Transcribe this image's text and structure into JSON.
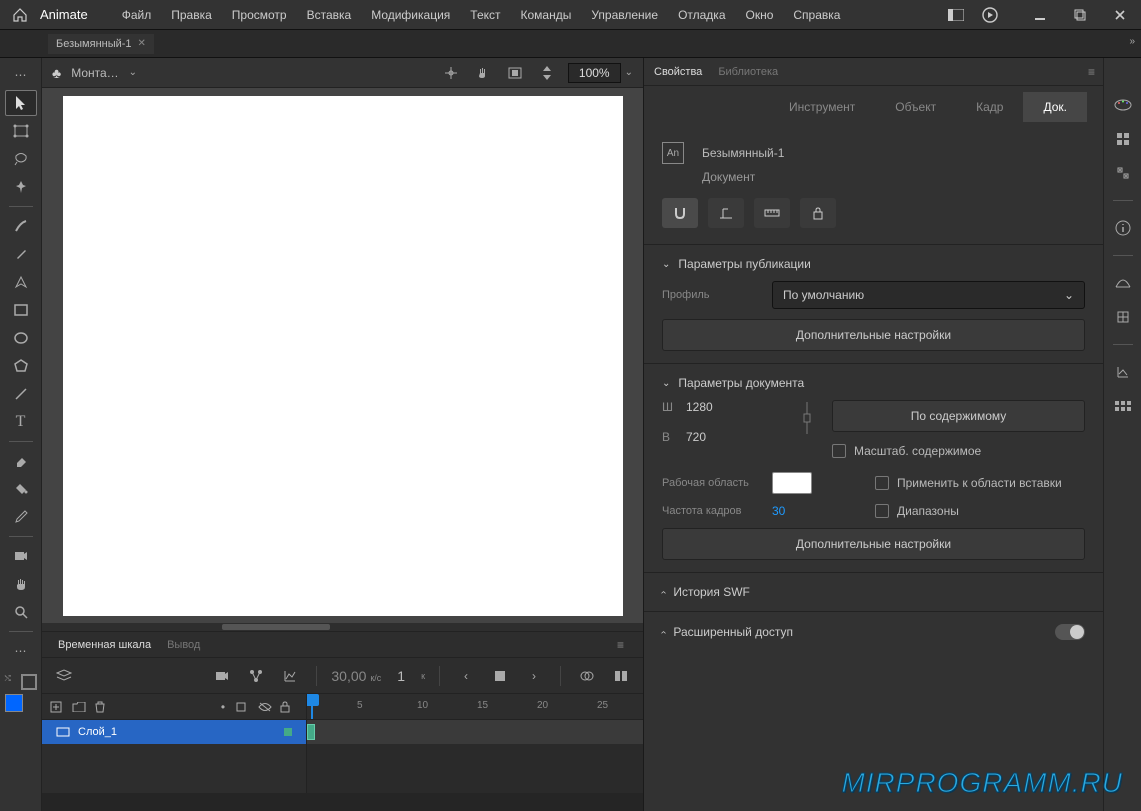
{
  "app": {
    "title": "Animate"
  },
  "menu": [
    "Файл",
    "Правка",
    "Просмотр",
    "Вставка",
    "Модификация",
    "Текст",
    "Команды",
    "Управление",
    "Отладка",
    "Окно",
    "Справка"
  ],
  "doc_tab": {
    "name": "Безымянный-1"
  },
  "stagebar": {
    "scene_label": "Монта…",
    "zoom": "100%"
  },
  "timeline": {
    "tab1": "Временная шкала",
    "tab2": "Вывод",
    "fps": "30,00",
    "fps_unit": "к/с",
    "frame": "1",
    "frame_mark": "к",
    "ruler": [
      "5",
      "10",
      "15",
      "20",
      "25"
    ],
    "layer_name": "Слой_1"
  },
  "props_panel": {
    "tabs": {
      "props": "Свойства",
      "lib": "Библиотека"
    },
    "subtabs": {
      "instr": "Инструмент",
      "obj": "Объект",
      "frame": "Кадр",
      "doc": "Док."
    },
    "doc_name": "Безымянный-1",
    "doc_type": "Документ",
    "pub": {
      "title": "Параметры публикации",
      "profile_label": "Профиль",
      "profile_value": "По умолчанию",
      "more_btn": "Дополнительные настройки"
    },
    "docparams": {
      "title": "Параметры документа",
      "w_label": "Ш",
      "w_value": "1280",
      "h_label": "В",
      "h_value": "720",
      "fit_btn": "По содержимому",
      "scale_cb": "Масштаб. содержимое",
      "stage_label": "Рабочая область",
      "apply_cb": "Применить к области вставки",
      "fps_label": "Частота кадров",
      "fps_value": "30",
      "ranges_cb": "Диапазоны",
      "more_btn": "Дополнительные настройки"
    },
    "swf_history": "История SWF",
    "ext_access": "Расширенный доступ"
  },
  "watermark": "MIRPROGRAMM.RU"
}
